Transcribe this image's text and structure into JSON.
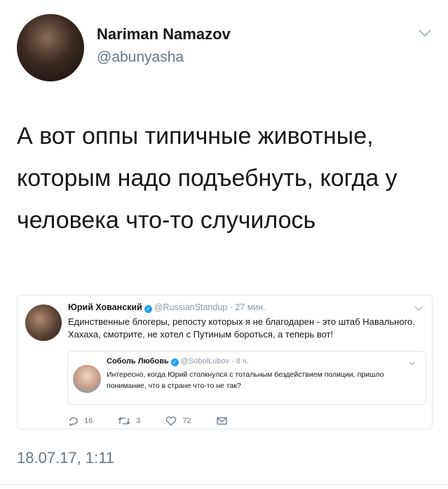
{
  "tweet": {
    "author_name": "Nariman Namazov",
    "author_handle": "@abunyasha",
    "text": "А вот оппы типичные животные, которым надо подъебнуть, когда у человека что-то случилось",
    "timestamp": "18.07.17, 1:11"
  },
  "embedded": {
    "author_name": "Юрий Хованский",
    "author_handle": "@RussianStandup",
    "time": "· 27 мин.",
    "text": "Единственные блогеры, репосту которых я не благодарен - это штаб Навального. Хахаха, смотрите, не хотел с Путиным бороться, а теперь вот!",
    "quote": {
      "author_name": "Соболь Любовь",
      "author_handle": "@SobolLubov",
      "time": "· 8 ч.",
      "text": "Интересно, когда Юрий столкнулся с тотальным бездействием полиции, пришло понимание, что в стране что-то не так?"
    },
    "actions": {
      "replies": "16",
      "retweets": "3",
      "likes": "72"
    }
  },
  "icons": [
    "chevron-down-icon",
    "verified-icon",
    "reply-icon",
    "retweet-icon",
    "like-icon",
    "message-icon"
  ],
  "colors": {
    "text": "#14171a",
    "secondary": "#657786",
    "verified": "#1da1f2",
    "border": "#e1e8ed"
  }
}
